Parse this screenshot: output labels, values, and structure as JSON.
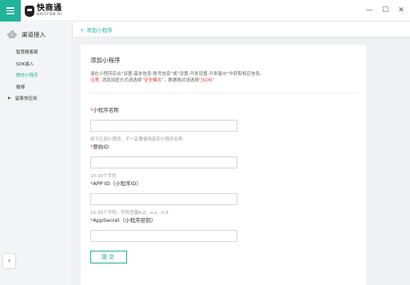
{
  "app": {
    "logo_cn": "快商通",
    "logo_en": "KAISTON AI"
  },
  "window_controls": {
    "minimize": "—",
    "maximize": "☐",
    "close": "✕"
  },
  "sidebar": {
    "header": "渠道接入",
    "items": [
      {
        "label": "智慧微客服"
      },
      {
        "label": "SDK接入"
      },
      {
        "label": "微信小程序"
      },
      {
        "label": "微博"
      },
      {
        "label": "留客快应用"
      }
    ],
    "collapse_icon": "‹"
  },
  "breadcrumb": {
    "back_icon": "‹",
    "label": "添加小程序"
  },
  "form": {
    "title": "添加小程序",
    "info_line1": "请在小程序后台“设置-基本信息-账号信息”或“设置-开发设置-开发者ID”中获取相应信息。",
    "note_label": "注意:",
    "note_text1": "消息加密方式请选择“",
    "note_hl1": "安全模式",
    "note_text2": "”，数据格式请选择“",
    "note_hl2": "JSON",
    "note_text3": "”",
    "fields": [
      {
        "label": "小程序名称",
        "value": "",
        "hint": "用于区别小程序，不一定要使用真实小程序名称"
      },
      {
        "label": "原始ID",
        "value": "",
        "hint": "10-30个字符"
      },
      {
        "label": "APP ID（小程序ID）",
        "value": "",
        "hint": "10-32个字符，字符范围A-Z、a-z、0-9"
      },
      {
        "label": "AppSecret（小程序密钥）",
        "value": "",
        "hint": ""
      }
    ],
    "required_mark": "*",
    "submit_label": "提交"
  }
}
